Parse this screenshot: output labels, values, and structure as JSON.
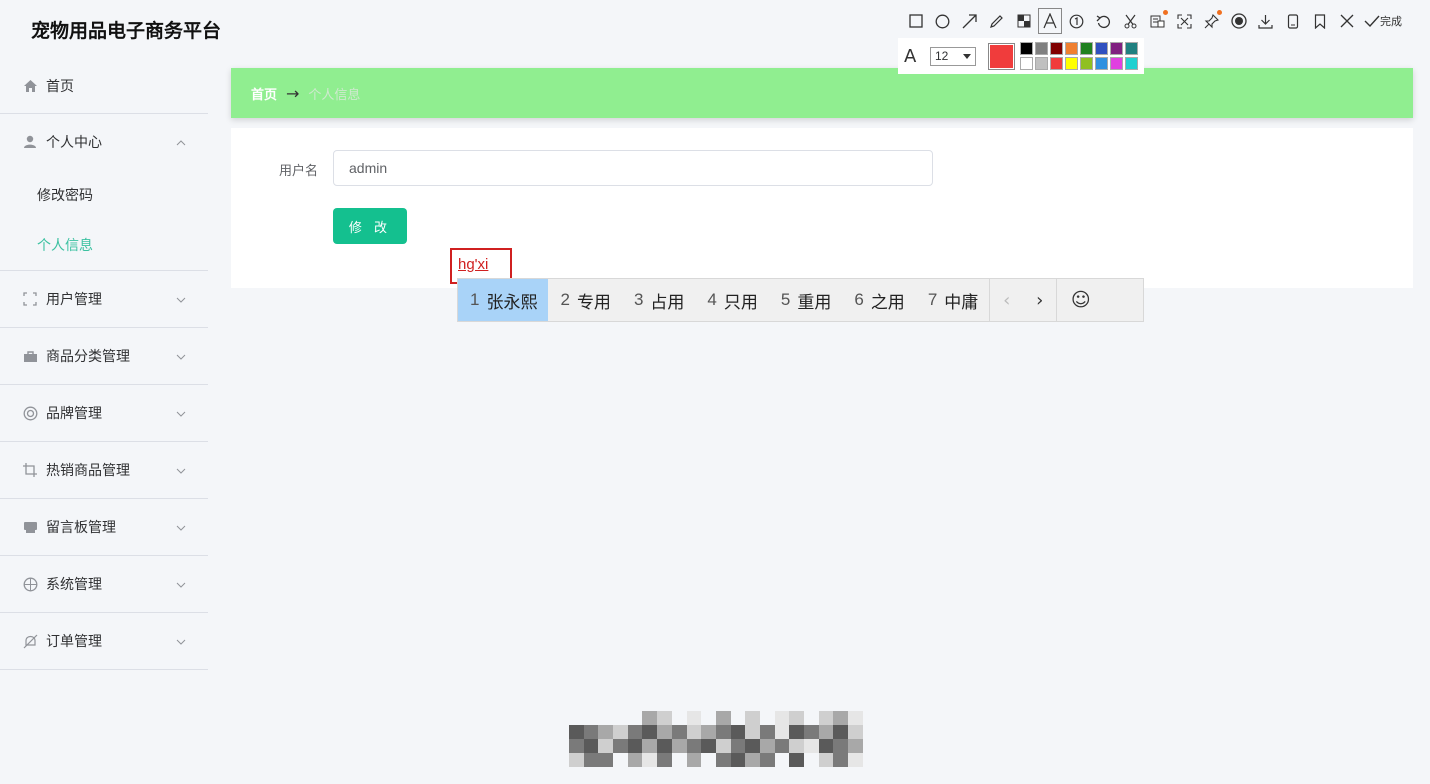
{
  "app": {
    "title": "宠物用品电子商务平台"
  },
  "sidebar": {
    "home": "首页",
    "personal_center": {
      "label": "个人中心",
      "items": [
        "修改密码",
        "个人信息"
      ],
      "active": "个人信息"
    },
    "menus": [
      {
        "label": "用户管理",
        "icon": "expand-icon"
      },
      {
        "label": "商品分类管理",
        "icon": "briefcase-icon"
      },
      {
        "label": "品牌管理",
        "icon": "lifebuoy-icon"
      },
      {
        "label": "热销商品管理",
        "icon": "crop-icon"
      },
      {
        "label": "留言板管理",
        "icon": "printer-icon"
      },
      {
        "label": "系统管理",
        "icon": "aperture-icon"
      },
      {
        "label": "订单管理",
        "icon": "bell-off-icon"
      }
    ]
  },
  "breadcrumb": {
    "home": "首页",
    "separator": "→",
    "current": "个人信息"
  },
  "form": {
    "username_label": "用户名",
    "username_value": "admin",
    "submit_label": "修 改"
  },
  "ime": {
    "composition": "hg'xi",
    "candidates": [
      {
        "n": "1",
        "text": "张永熙"
      },
      {
        "n": "2",
        "text": "专用"
      },
      {
        "n": "3",
        "text": "占用"
      },
      {
        "n": "4",
        "text": "只用"
      },
      {
        "n": "5",
        "text": "重用"
      },
      {
        "n": "6",
        "text": "之用"
      },
      {
        "n": "7",
        "text": "中庸"
      }
    ],
    "selected_index": 0
  },
  "annotation_tool": {
    "tools": [
      "rectangle-icon",
      "circle-icon",
      "arrow-icon",
      "pen-icon",
      "mosaic-icon",
      "text-icon",
      "number-icon",
      "undo-icon",
      "scissors-icon",
      "ocr-icon",
      "expand-icon",
      "pin-icon",
      "record-icon",
      "download-icon",
      "phone-icon",
      "bookmark-icon",
      "close-icon"
    ],
    "done_label": "完成",
    "font_size": "12",
    "current_color": "#f03c3c",
    "palette": [
      "#000000",
      "#808080",
      "#800000",
      "#f08030",
      "#208020",
      "#3050c0",
      "#802080",
      "#208080",
      "#ffffff",
      "#c0c0c0",
      "#f03c3c",
      "#ffff00",
      "#90c020",
      "#3090e0",
      "#e040e0",
      "#20d0d0"
    ]
  },
  "colors": {
    "accent": "#14c08f",
    "breadcrumb_bg": "#90ee90",
    "active_menu": "#3cc1a1"
  }
}
